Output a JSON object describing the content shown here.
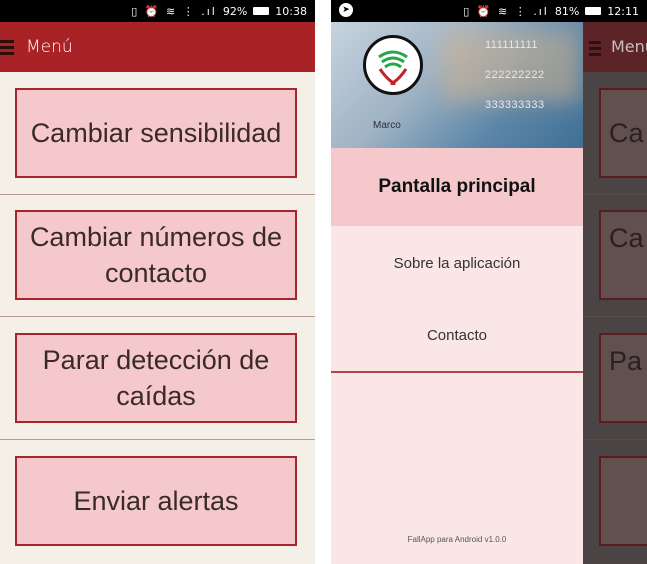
{
  "left": {
    "status": {
      "icons": "▯ ⏰ ≋ ⋮ .ıl",
      "battery_pct": "92%",
      "time": "10:38"
    },
    "appbar": {
      "title": "Menú"
    },
    "buttons": [
      {
        "label": "Cambiar sensibilidad"
      },
      {
        "label": "Cambiar números de contacto"
      },
      {
        "label": "Parar detección de caídas"
      },
      {
        "label": "Enviar alertas"
      }
    ]
  },
  "right": {
    "status": {
      "icons": "▯ ⏰ ≋ ⋮ .ıl",
      "battery_pct": "81%",
      "time": "12:11"
    },
    "drawer": {
      "numbers": [
        "111111111",
        "222222222",
        "333333333"
      ],
      "user_name": "Marco",
      "items": [
        {
          "label": "Pantalla principal"
        },
        {
          "label": "Sobre la aplicación"
        },
        {
          "label": "Contacto"
        }
      ],
      "version": "FallApp para Android v1.0.0"
    },
    "peek": {
      "title": "Menú",
      "buttons": [
        "Ca",
        "Ca",
        "Pa",
        ""
      ]
    }
  },
  "colors": {
    "appbar": "#a92226",
    "button_bg": "#f5c9cb",
    "button_border": "#a2262a",
    "background": "#f4f0e7",
    "drawer_bg": "#fbe6e7"
  }
}
